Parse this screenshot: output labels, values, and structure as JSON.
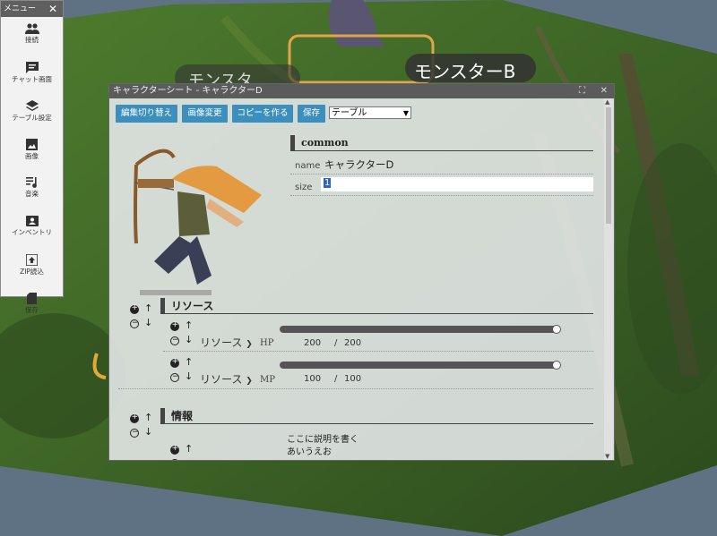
{
  "menu": {
    "title": "メニュー",
    "items": [
      {
        "label": "接続",
        "icon": "people-icon"
      },
      {
        "label": "チャット画面",
        "icon": "chat-icon"
      },
      {
        "label": "テーブル設定",
        "icon": "layers-icon"
      },
      {
        "label": "画像",
        "icon": "image-icon"
      },
      {
        "label": "音楽",
        "icon": "music-icon"
      },
      {
        "label": "インベントリ",
        "icon": "inventory-icon"
      },
      {
        "label": "ZIP読込",
        "icon": "zip-upload-icon"
      },
      {
        "label": "保存",
        "icon": "save-icon"
      }
    ]
  },
  "board": {
    "token_label_monster": "モンスターB",
    "token_label_partial": "モンスタ",
    "watermark_1": "キャラクターD",
    "watermark_2": "キャラクターD"
  },
  "sheet": {
    "title": "キャラクターシート - キャラクターD",
    "toolbar": {
      "toggle_edit": "編集切り替え",
      "change_image": "画像変更",
      "make_copy": "コピーを作る",
      "save": "保存",
      "select_value": "テーブル"
    },
    "common": {
      "heading": "common",
      "name_label": "name",
      "name_value": "キャラクターD",
      "size_label": "size",
      "size_value": "1"
    },
    "resources": {
      "heading": "リソース",
      "rows": [
        {
          "name": "リソース",
          "key": "HP",
          "current": "200",
          "sep": "/",
          "max": "200",
          "fill": 1.0
        },
        {
          "name": "リソース",
          "key": "MP",
          "current": "100",
          "sep": "/",
          "max": "100",
          "fill": 1.0
        }
      ]
    },
    "info": {
      "heading": "情報",
      "line1": "ここに説明を書く",
      "line2": "あいうえお"
    }
  },
  "colors": {
    "accent_button": "#3c8fbd",
    "titlebar": "#5b5b5b",
    "forest": "#3f6b2a"
  }
}
